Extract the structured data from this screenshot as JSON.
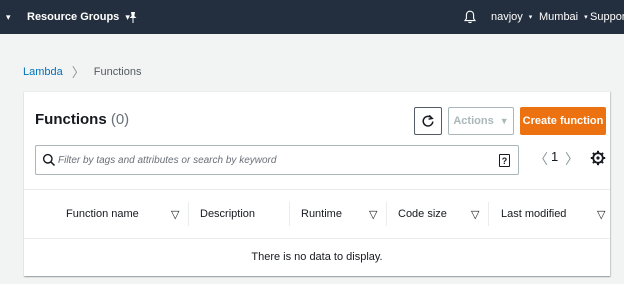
{
  "topnav": {
    "menu_caret": "▾",
    "resource_groups": "Resource Groups",
    "resource_groups_caret": "▾",
    "pin_icon": "pin-icon",
    "bell_icon": "bell-icon",
    "user": "navjoy",
    "user_caret": "▾",
    "region": "Mumbai",
    "region_caret": "▾",
    "support": "Support",
    "bg_color": "#232f3e"
  },
  "breadcrumb": {
    "parent": "Lambda",
    "separator": "〉",
    "current": "Functions"
  },
  "panel": {
    "title": "Functions",
    "count": "(0)",
    "actions_label": "Actions",
    "actions_caret": "▼",
    "create_label": "Create function",
    "create_color": "#ec7211",
    "search_placeholder": "Filter by tags and attributes or search by keyword",
    "help_glyph": "?",
    "pager_prev": "〈",
    "page_number": "1",
    "pager_next": "〉"
  },
  "table": {
    "columns": [
      {
        "label": "Function name",
        "sort": "▽"
      },
      {
        "label": "Description",
        "sort": ""
      },
      {
        "label": "Runtime",
        "sort": "▽"
      },
      {
        "label": "Code size",
        "sort": "▽"
      },
      {
        "label": "Last modified",
        "sort": "▽"
      }
    ],
    "empty_message": "There is no data to display."
  }
}
